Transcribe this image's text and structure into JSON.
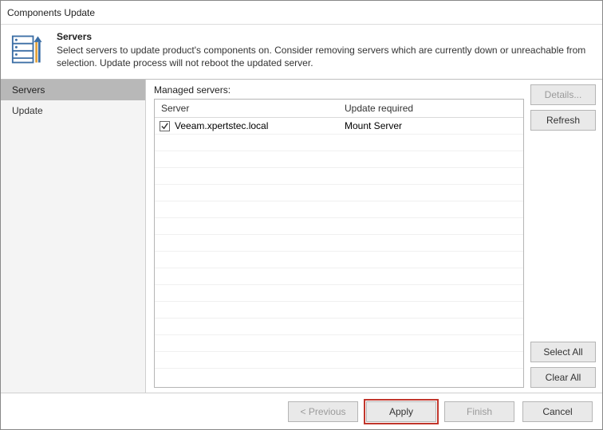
{
  "window": {
    "title": "Components Update"
  },
  "header": {
    "heading": "Servers",
    "description": "Select servers to update product's components on. Consider removing servers which are currently down or unreachable from selection. Update process will not reboot the updated server."
  },
  "nav": {
    "items": [
      {
        "label": "Servers",
        "active": true
      },
      {
        "label": "Update",
        "active": false
      }
    ]
  },
  "content": {
    "label": "Managed servers:",
    "columns": {
      "server": "Server",
      "update_required": "Update required"
    },
    "rows": [
      {
        "checked": true,
        "server": "Veeam.xpertstec.local",
        "update_required": "Mount Server"
      }
    ]
  },
  "side_buttons": {
    "details": "Details...",
    "refresh": "Refresh",
    "select_all": "Select All",
    "clear_all": "Clear All"
  },
  "footer": {
    "previous": "< Previous",
    "apply": "Apply",
    "finish": "Finish",
    "cancel": "Cancel"
  }
}
